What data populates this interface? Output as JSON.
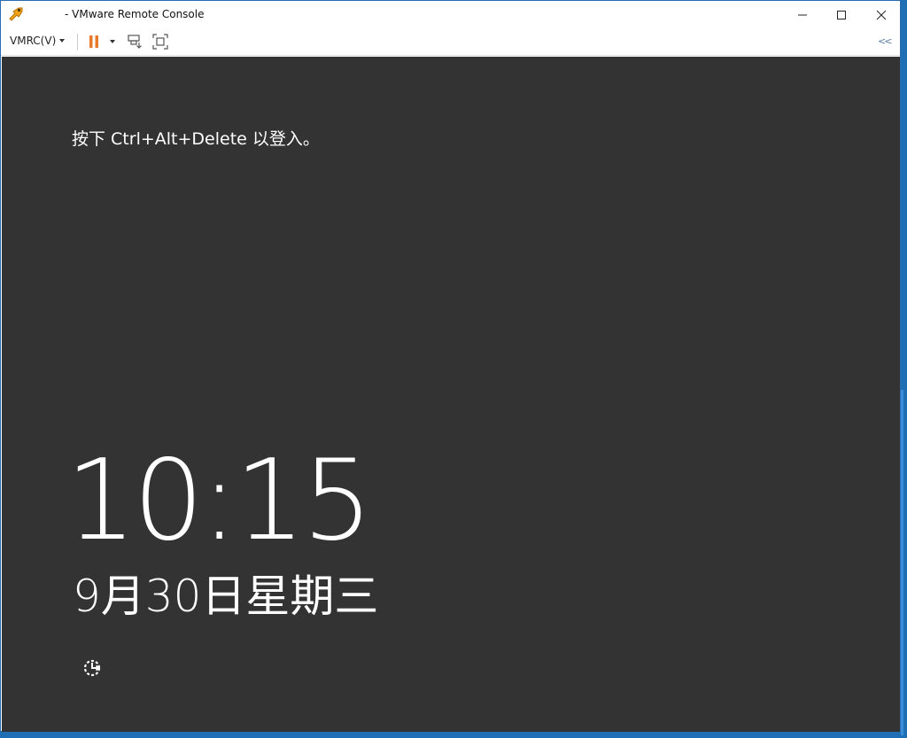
{
  "window": {
    "title": "- VMware Remote Console",
    "app_icon": "vmware-app-icon",
    "controls": {
      "minimize_icon": "minimize-icon",
      "maximize_icon": "maximize-icon",
      "close_icon": "close-icon"
    }
  },
  "toolbar": {
    "vmrc_menu_label": "VMRC(V)",
    "pause_icon": "pause-icon",
    "send_keys_icon": "send-ctrl-alt-del-icon",
    "fit_icon": "fit-screen-icon",
    "collapse_label": "<<"
  },
  "console": {
    "prompt": "按下 Ctrl+Alt+Delete 以登入。",
    "time": "10:15",
    "date": "9月30日星期三",
    "ease_of_access_icon": "ease-of-access-icon"
  },
  "colors": {
    "console_bg": "#333333",
    "accent_orange": "#e8782a",
    "window_border": "#2b6cb0"
  }
}
